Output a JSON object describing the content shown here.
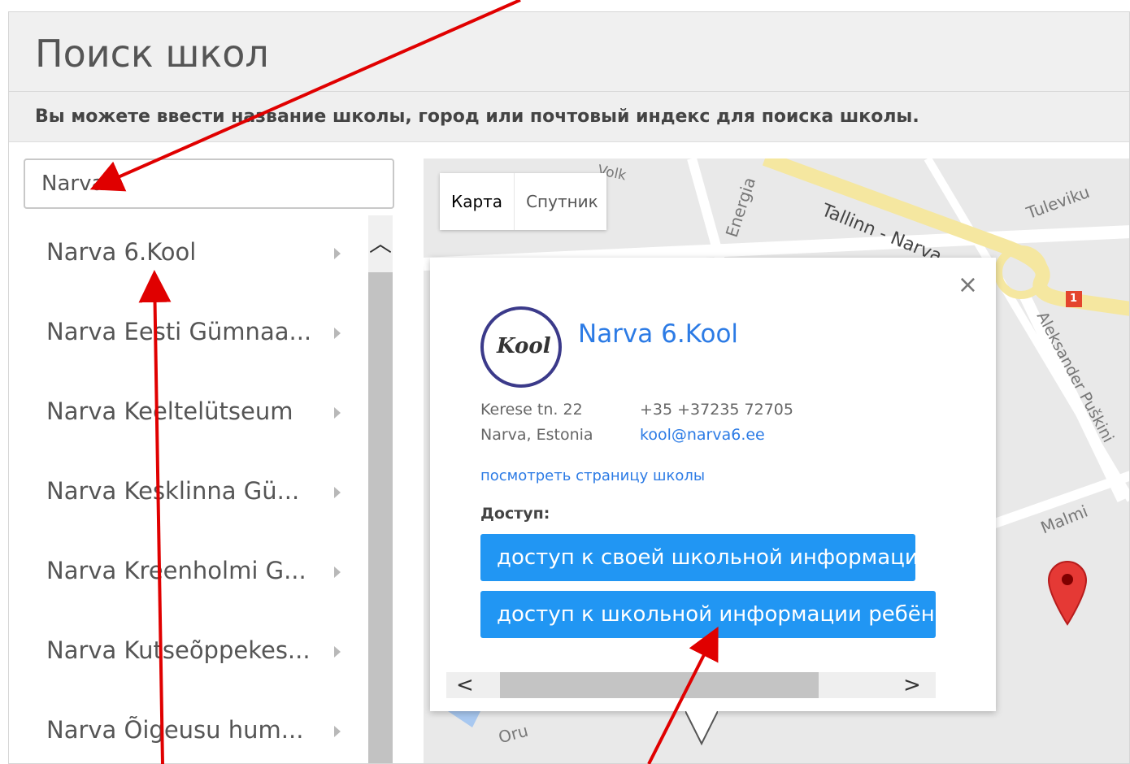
{
  "page": {
    "title": "Поиск школ",
    "subtitle": "Вы можете ввести название школы, город или почтовый индекс для поиска школы."
  },
  "search": {
    "value": "Narva"
  },
  "results": [
    {
      "label": "Narva 6.Kool"
    },
    {
      "label": "Narva Eesti Gümnaa..."
    },
    {
      "label": "Narva Keeltelütseum"
    },
    {
      "label": "Narva Kesklinna Gü..."
    },
    {
      "label": "Narva Kreenholmi G..."
    },
    {
      "label": "Narva Kutseõppekes..."
    },
    {
      "label": "Narva Õigeusu hum..."
    }
  ],
  "map": {
    "tabs": [
      {
        "label": "Карта"
      },
      {
        "label": "Спутник"
      }
    ],
    "labels": {
      "road_main": "Tallinn - Narva",
      "tuleviku": "Tuleviku",
      "energia": "Energia",
      "puskini": "Aleksander Puškini",
      "malmi": "Malmi",
      "oru": "Oru",
      "volk": "Volk",
      "route_number": "1"
    }
  },
  "popup": {
    "close": "×",
    "logo_text": "Kool",
    "school_name": "Narva 6.Kool",
    "address_line1": "Kerese tn. 22",
    "address_line2": "Narva, Estonia",
    "phone": "+35 +37235 72705",
    "email": "kool@narva6.ee",
    "view_page": "посмотреть страницу школы",
    "access_label": "Доступ:",
    "btn_own": "доступ к своей школьной информации",
    "btn_child": "доступ к школьной информации ребёнка",
    "scroll_left": "<",
    "scroll_right": ">"
  },
  "colors": {
    "link": "#2c7be5",
    "button": "#2196f3",
    "arrow": "#e00000",
    "road": "#f5e7a0"
  }
}
